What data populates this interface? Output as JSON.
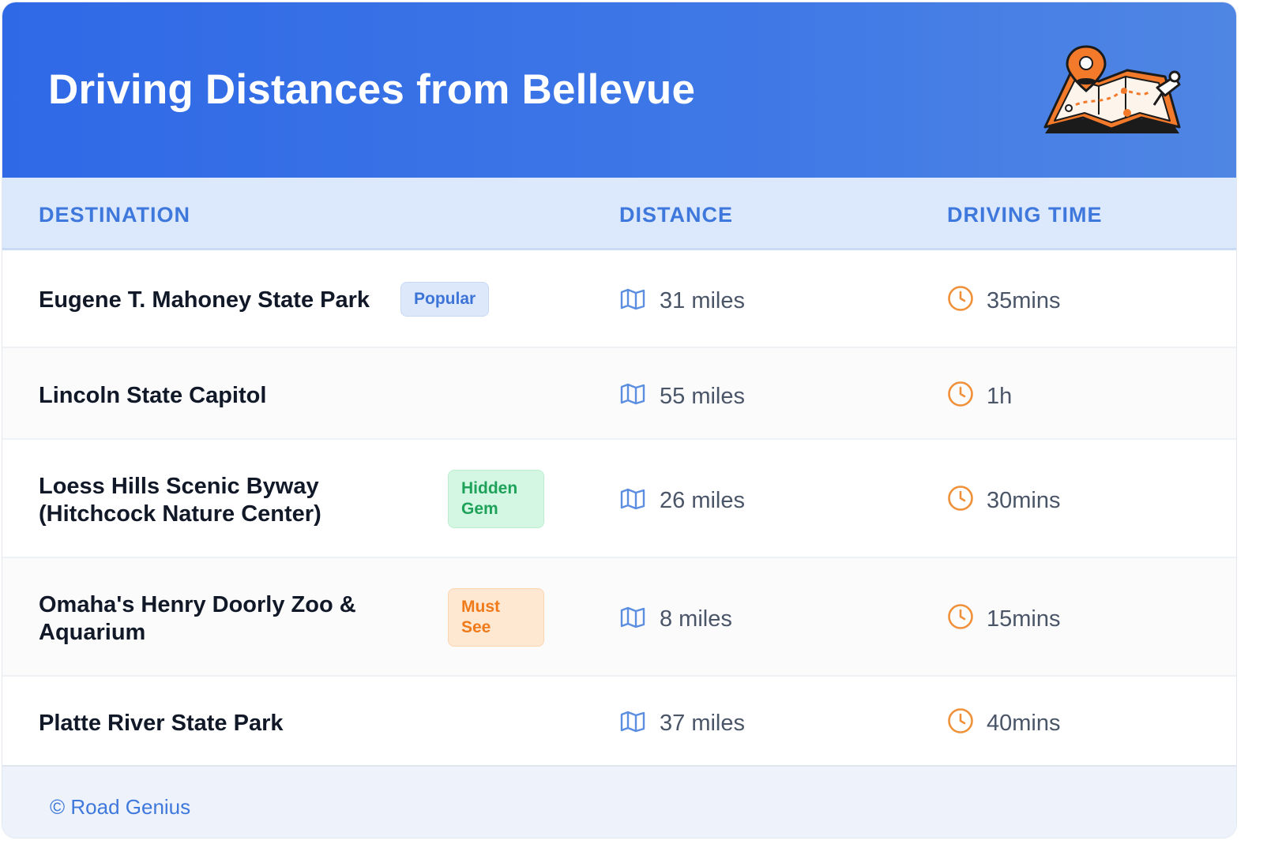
{
  "header": {
    "title": "Driving Distances from Bellevue"
  },
  "table": {
    "columns": [
      "DESTINATION",
      "DISTANCE",
      "DRIVING TIME"
    ],
    "rows": [
      {
        "destination": "Eugene T. Mahoney State Park",
        "badge": "Popular",
        "badge_kind": "popular",
        "distance": "31 miles",
        "time": "35mins"
      },
      {
        "destination": "Lincoln State Capitol",
        "badge": "",
        "badge_kind": "",
        "distance": "55 miles",
        "time": "1h"
      },
      {
        "destination": "Loess Hills Scenic Byway (Hitchcock Nature Center)",
        "badge": "Hidden Gem",
        "badge_kind": "gem",
        "distance": "26 miles",
        "time": "30mins"
      },
      {
        "destination": "Omaha's Henry Doorly Zoo & Aquarium",
        "badge": "Must See",
        "badge_kind": "must",
        "distance": "8 miles",
        "time": "15mins"
      },
      {
        "destination": "Platte River State Park",
        "badge": "",
        "badge_kind": "",
        "distance": "37 miles",
        "time": "40mins"
      }
    ]
  },
  "footer": {
    "credit": "© Road Genius"
  },
  "icons": {
    "distance_icon": "map-icon",
    "time_icon": "clock-icon",
    "header_illustration": "map-with-pin-illustration"
  },
  "colors": {
    "header_blue": "#2f69e6",
    "accent_blue": "#3f78dc",
    "clock_orange": "#f0913a",
    "gem_green": "#1ea25a",
    "must_orange": "#f07a1a"
  }
}
